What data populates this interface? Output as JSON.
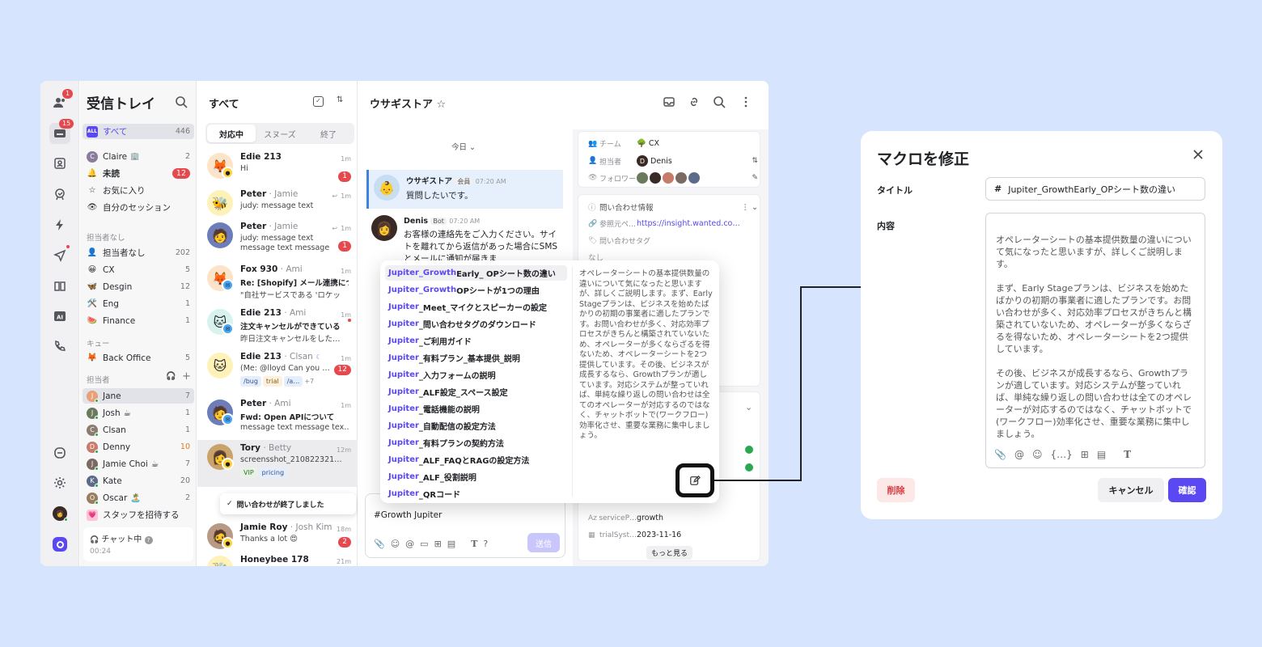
{
  "rail": {
    "people_badge": "1",
    "inbox_badge": "15"
  },
  "sidebar": {
    "title": "受信トレイ",
    "all_label": "すべて",
    "all_count": "446",
    "claire": "Claire",
    "claire_count": "2",
    "unread": "未読",
    "unread_count": "12",
    "favorites": "お気に入り",
    "my_sessions": "自分のセッション",
    "unassigned_head": "担当者なし",
    "unassigned": "担当者なし",
    "unassigned_count": "202",
    "teams": [
      {
        "name": "CX",
        "count": "5",
        "icon": "😀"
      },
      {
        "name": "Desgin",
        "count": "12",
        "icon": "🦋"
      },
      {
        "name": "Eng",
        "count": "1",
        "icon": "🛠️"
      },
      {
        "name": "Finance",
        "count": "1",
        "icon": "🍉"
      }
    ],
    "queue_head": "キュー",
    "back_office": "Back Office",
    "back_office_count": "5",
    "assignee_head": "担当者",
    "assignees": [
      {
        "name": "Jane",
        "count": "7",
        "color": "#e8a077",
        "suffix": ""
      },
      {
        "name": "Josh",
        "count": "1",
        "color": "#6b7a5c",
        "suffix": "☕"
      },
      {
        "name": "Clsan",
        "count": "1",
        "color": "#8a7d70",
        "suffix": ""
      },
      {
        "name": "Denny",
        "count": "10",
        "color": "#c77b6a",
        "suffix": ""
      },
      {
        "name": "Jamie Choi",
        "count": "7",
        "color": "#7a6a62",
        "suffix": "☕"
      },
      {
        "name": "Kate",
        "count": "20",
        "color": "#5b6c8a",
        "suffix": ""
      },
      {
        "name": "Oscar",
        "count": "2",
        "color": "#9a7c5e",
        "suffix": "🏝️"
      }
    ],
    "invite": "スタッフを招待する",
    "chat_status": "チャット中",
    "chat_time": "00:24"
  },
  "list": {
    "title": "すべて",
    "tabs": [
      "対応中",
      "スヌーズ",
      "終了"
    ],
    "items": [
      {
        "name": "Edie 213",
        "sub": "",
        "time": "1m",
        "msg": "Hi",
        "count": "1",
        "avatar": "🦊",
        "bg": "#fde3c8"
      },
      {
        "name": "Peter",
        "sub": " · Jamie",
        "time": "1m",
        "msg": "judy: message text",
        "count": "",
        "avatar": "🐝",
        "bg": "#fff2b8"
      },
      {
        "name": "Peter",
        "sub": " · Jamie",
        "time": "1m",
        "msg": "judy: message text",
        "msg2": "message text message",
        "count": "1",
        "avatar": "🧑",
        "bg": "#6c7dba"
      },
      {
        "name": "Fox 930",
        "sub": " · Ami",
        "time": "1m",
        "msg": "Re: [Shopify] メール連携につ",
        "msg2": "\"自社サービスである 'ロケッ",
        "count": "",
        "avatar": "🦊",
        "bg": "#fde3c8"
      },
      {
        "name": "Edie 213",
        "sub": " · Ami",
        "time": "1m",
        "msg": "注文キャンセルができている",
        "msg2": "昨日注文キャンセルをした…",
        "count": "",
        "avatar": "🐱",
        "bg": "#d8f3ee"
      },
      {
        "name": "Edie 213",
        "sub": " · Clsan",
        "time": "1m",
        "msg": "(Me: @lloyd Can you …",
        "count": "12",
        "avatar": "🐱",
        "bg": "#fff2b8"
      },
      {
        "name": "Peter",
        "sub": " · Ami",
        "time": "1m",
        "msg": "Fwd: Open APIについて",
        "msg2": "message text message tex…",
        "count": "",
        "avatar": "🧑",
        "bg": "#6c7dba"
      },
      {
        "name": "Tory",
        "sub": " · Betty",
        "time": "12m",
        "msg": "screensshot_210822321…",
        "count": "",
        "avatar": "👩",
        "bg": "#c9a36a"
      },
      {
        "name": "Jamie Roy",
        "sub": " · Josh Kim",
        "time": "18m",
        "msg": "Thanks a lot 😍",
        "count": "2",
        "avatar": "🧔",
        "bg": "#b89a84"
      },
      {
        "name": "Honeybee 178",
        "sub": "",
        "time": "21m",
        "msg": "",
        "count": "",
        "avatar": "🐝",
        "bg": "#fff2b8"
      }
    ],
    "tags_edie": [
      "/bug",
      "trial",
      "/a…",
      "+7"
    ],
    "tags_tory": [
      "VIP",
      "pricing"
    ],
    "closed_toast": "問い合わせが終了しました"
  },
  "chat": {
    "title": "ウサギストア",
    "today": "今日",
    "bubble_name": "ウサギストア",
    "bubble_tag": "会員",
    "bubble_time": "07:20 AM",
    "bubble_text": "質問したいです。",
    "reply_name": "Denis",
    "reply_tag": "Bot",
    "reply_time": "07:20 AM",
    "reply_text": "お客様の連絡先をご入力ください。サイトを離れてから返信があった場合にSMSとメールに通知が届きま",
    "composer_text": "#Growth Jupiter",
    "send": "送信"
  },
  "info": {
    "team_label": "チーム",
    "team_value": "CX",
    "assignee_label": "担当者",
    "assignee_value": "Denis",
    "follower_label": "フォロワー",
    "inquiry_title": "問い合わせ情報",
    "ref_label": "参照元ペ…",
    "ref_value": "https://insight.wanted.co…",
    "tag_label": "問い合わせタグ",
    "tag_none": "なし",
    "service_label": "serviceP…",
    "service_value": "growth",
    "trial_label": "trialSyst…",
    "trial_value": "2023-11-16",
    "more": "もっと見る"
  },
  "macro_popup": {
    "items": [
      {
        "hl": "Jupiter_Growth",
        "rest": "Early_ OPシート数の違い"
      },
      {
        "hl": "Jupiter_Growth",
        "rest": "OPシートが1つの理由"
      },
      {
        "hl": "Jupiter",
        "rest": "_Meet_マイクとスピーカーの設定"
      },
      {
        "hl": "Jupiter",
        "rest": "_問い合わせタグのダウンロード"
      },
      {
        "hl": "Jupiter",
        "rest": "_ご利用ガイド"
      },
      {
        "hl": "Jupiter",
        "rest": "_有料プラン_基本提供_説明"
      },
      {
        "hl": "Jupiter",
        "rest": "_入力フォームの説明"
      },
      {
        "hl": "Jupiter",
        "rest": "_ALF設定_スペース設定"
      },
      {
        "hl": "Jupiter",
        "rest": "_電話機能の説明"
      },
      {
        "hl": "Jupiter",
        "rest": "_自動配信の設定方法"
      },
      {
        "hl": "Jupiter",
        "rest": "_有料プランの契約方法"
      },
      {
        "hl": "Jupiter",
        "rest": "_ALF_FAQとRAGの設定方法"
      },
      {
        "hl": "Jupiter",
        "rest": "_ALF_役割説明"
      },
      {
        "hl": "Jupiter",
        "rest": "_QRコード"
      }
    ],
    "preview": "オペレーターシートの基本提供数量の違いについて気になったと思いますが、詳しくご説明します。まず、Early Stageプランは、ビジネスを始めたばかりの初期の事業者に適したプランです。お問い合わせが多く、対応効率プロセスがきちんと構築されていないため、オペレーターが多くならざるを得ないため、オペレーターシートを2つ提供しています。その後、ビジネスが成長するなら、Growthプランが適しています。対応システムが整っていれば、単純な繰り返しの問い合わせは全てのオペレーターが対応するのではなく、チャットボットで(ワークフロー)効率化させ、重要な業務に集中しましょう。"
  },
  "modal": {
    "title": "マクロを修正",
    "title_label": "タイトル",
    "title_value": "Jupiter_GrowthEarly_OPシート数の違い",
    "content_label": "内容",
    "content": "オペレーターシートの基本提供数量の違いについて気になったと思いますが、詳しくご説明します。\n\nまず、Early Stageプランは、ビジネスを始めたばかりの初期の事業者に適したプランです。お問い合わせが多く、対応効率プロセスがきちんと構築されていないため、オペレーターが多くならざるを得ないため、オペレーターシートを2つ提供しています。\n\nその後、ビジネスが成長するなら、Growthプランが適しています。対応システムが整っていれば、単純な繰り返しの問い合わせは全てのオペレーターが対応するのではなく、チャットボットで(ワークフロー)効率化させ、重要な業務に集中しましょう。",
    "delete": "削除",
    "cancel": "キャンセル",
    "confirm": "確認"
  }
}
